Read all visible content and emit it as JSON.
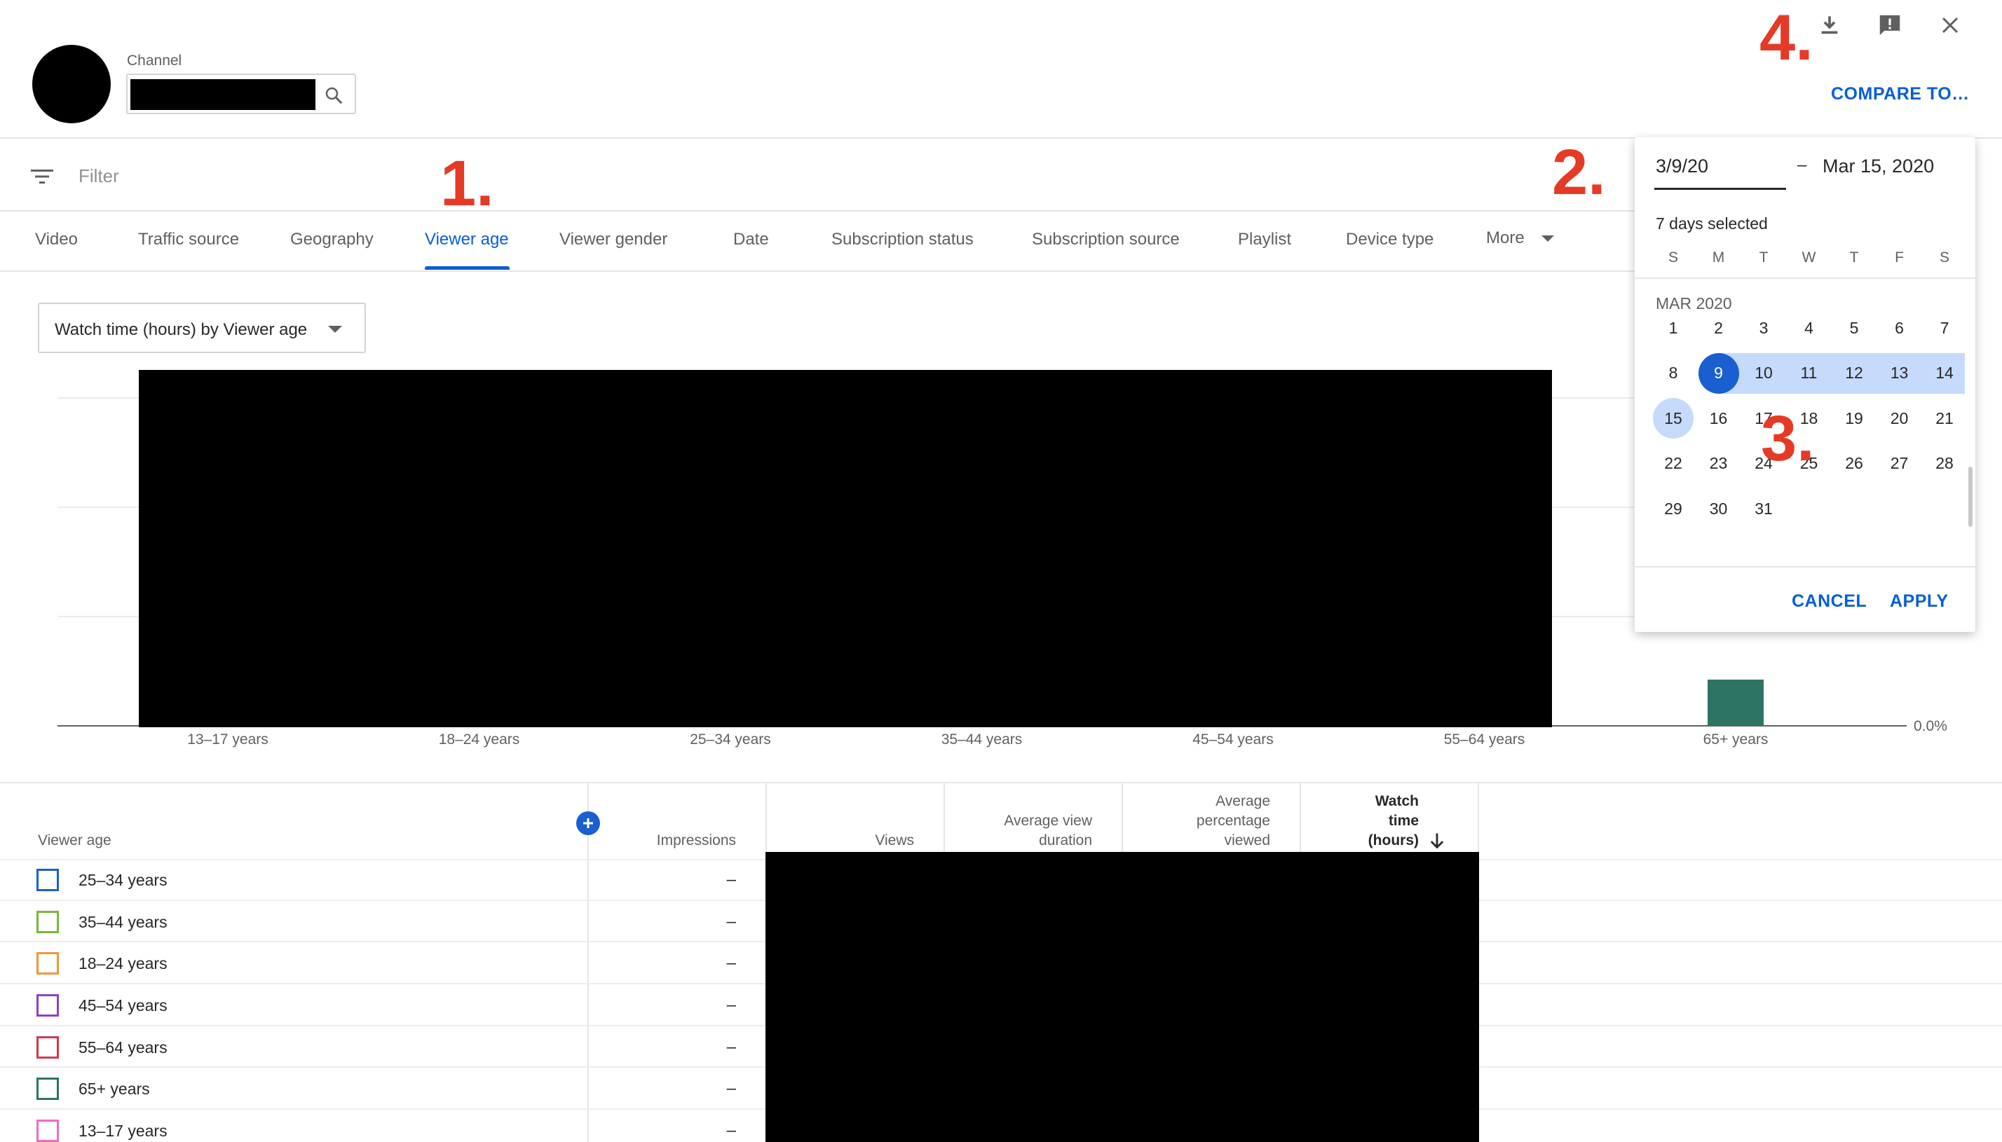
{
  "header": {
    "channel_label": "Channel",
    "compare_label": "COMPARE TO…"
  },
  "annotations": [
    "1.",
    "2.",
    "3.",
    "4."
  ],
  "filter": {
    "placeholder": "Filter"
  },
  "tabs": [
    {
      "label": "Video"
    },
    {
      "label": "Traffic source"
    },
    {
      "label": "Geography"
    },
    {
      "label": "Viewer age",
      "active": true
    },
    {
      "label": "Viewer gender"
    },
    {
      "label": "Date"
    },
    {
      "label": "Subscription status"
    },
    {
      "label": "Subscription source"
    },
    {
      "label": "Playlist"
    },
    {
      "label": "Device type"
    },
    {
      "label": "More"
    }
  ],
  "metric_dropdown": {
    "selected": "Watch time (hours) by Viewer age"
  },
  "chart_data": {
    "type": "bar",
    "categories": [
      "13–17 years",
      "18–24 years",
      "25–34 years",
      "35–44 years",
      "45–54 years",
      "55–64 years",
      "65+ years"
    ],
    "ytick_labels": [
      "0.0%"
    ],
    "visible_bar": {
      "category": "65+ years",
      "color": "#2e7465"
    },
    "redacted_region": true
  },
  "table": {
    "columns": {
      "viewer_age": "Viewer age",
      "impressions": "Impressions",
      "views": "Views",
      "avg_view_duration": [
        "Average view",
        "duration"
      ],
      "avg_pct_viewed": [
        "Average",
        "percentage",
        "viewed"
      ],
      "watch_time": [
        "Watch",
        "time",
        "(hours)"
      ]
    },
    "sort_icon": "arrow-down-icon",
    "add_column_icon": "plus-circle-icon",
    "rows": [
      {
        "label": "25–34 years",
        "color": "#1a5fd0",
        "impressions": "–"
      },
      {
        "label": "35–44 years",
        "color": "#7cb342",
        "impressions": "–"
      },
      {
        "label": "18–24 years",
        "color": "#f09837",
        "impressions": "–"
      },
      {
        "label": "45–54 years",
        "color": "#8e3fd0",
        "impressions": "–"
      },
      {
        "label": "55–64 years",
        "color": "#d1394f",
        "impressions": "–"
      },
      {
        "label": "65+ years",
        "color": "#2e7465",
        "impressions": "–"
      },
      {
        "label": "13–17 years",
        "color": "#f06bc4",
        "impressions": "–"
      }
    ]
  },
  "date_picker": {
    "start_value": "3/9/20",
    "separator": "–",
    "end_value": "Mar 15, 2020",
    "selected_count": "7 days selected",
    "weekdays": [
      "S",
      "M",
      "T",
      "W",
      "T",
      "F",
      "S"
    ],
    "month_label": "MAR 2020",
    "weeks": [
      [
        "1",
        "2",
        "3",
        "4",
        "5",
        "6",
        "7"
      ],
      [
        "8",
        "9",
        "10",
        "11",
        "12",
        "13",
        "14"
      ],
      [
        "15",
        "16",
        "17",
        "18",
        "19",
        "20",
        "21"
      ],
      [
        "22",
        "23",
        "24",
        "25",
        "26",
        "27",
        "28"
      ],
      [
        "29",
        "30",
        "31"
      ]
    ],
    "range_start": "9",
    "range_end": "15",
    "cancel_label": "CANCEL",
    "apply_label": "APPLY"
  },
  "colors": {
    "accent": "#065fd4",
    "annotation": "#e53a26",
    "range_fill": "#c6dafc"
  }
}
